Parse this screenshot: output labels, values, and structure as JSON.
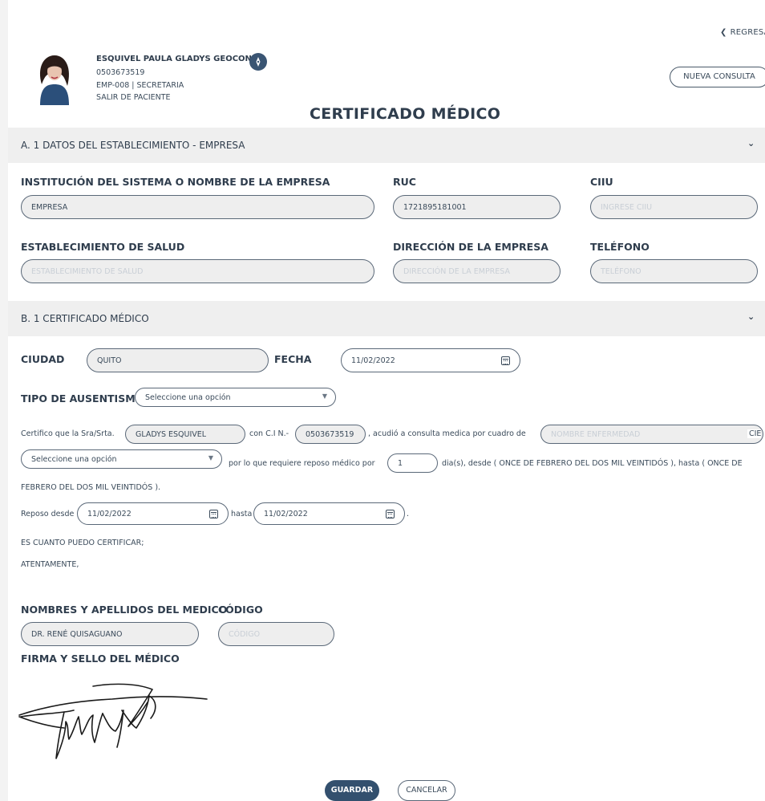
{
  "nav": {
    "back_label": "REGRESA"
  },
  "patient": {
    "name": "ESQUIVEL PAULA GLADYS GEOCONDA",
    "id_number": "0503673519",
    "employee": "EMP-008 | SECRETARIA",
    "status": "SALIR DE PACIENTE"
  },
  "actions": {
    "new_consult_label": "NUEVA CONSULTA"
  },
  "page": {
    "title": "CERTIFICADO MÉDICO"
  },
  "section_a": {
    "title": "A. 1 DATOS DEL ESTABLECIMIENTO - EMPRESA",
    "institution_label": "INSTITUCIÓN DEL SISTEMA O NOMBRE DE LA EMPRESA",
    "institution_value": "EMPRESA",
    "ruc_label": "RUC",
    "ruc_value": "1721895181001",
    "ciiu_label": "CIIU",
    "ciiu_placeholder": "INGRESE CIIU",
    "establishment_label": "ESTABLECIMIENTO DE SALUD",
    "establishment_placeholder": "ESTABLECIMIENTO DE SALUD",
    "address_label": "DIRECCIÓN DE LA EMPRESA",
    "address_placeholder": "DIRECCIÓN DE LA EMPRESA",
    "phone_label": "TELÉFONO",
    "phone_placeholder": "TELÉFONO"
  },
  "section_b": {
    "title": "B. 1 CERTIFICADO MÉDICO",
    "city_label": "CIUDAD",
    "city_value": "QUITO",
    "date_label": "FECHA",
    "date_value": "11/02/2022",
    "absence_type_label": "TIPO DE AUSENTISMO",
    "absence_type_value": "Seleccione una opción",
    "cert_text_1": "Certifico que la Sra/Srta.",
    "patient_name_value": "GLADYS  ESQUIVEL",
    "cert_text_2": "con C.I N.-",
    "ci_value": "0503673519",
    "cert_text_3": ", acudió a consulta medica por cuadro de",
    "disease_placeholder": "NOMBRE ENFERMEDAD",
    "cie_label": "CIE",
    "cie_select_value": "Seleccione una opción",
    "cert_text_4": "por lo que requiere reposo médico por",
    "rest_days_value": "1",
    "cert_text_5": "dia(s), desde ( ONCE DE FEBRERO DEL DOS MIL VEINTIDÓS ), hasta ( ONCE DE",
    "cert_text_6": "FEBRERO DEL DOS MIL VEINTIDÓS ).",
    "rest_from_label": "Reposo desde",
    "rest_from_value": "11/02/2022",
    "rest_to_label": "hasta",
    "rest_to_value": "11/02/2022",
    "period": ".",
    "closing_1": "ES CUANTO PUEDO CERTIFICAR;",
    "closing_2": "ATENTAMENTE,",
    "doctor_label": "NOMBRES Y APELLIDOS DEL MEDICO",
    "doctor_value": "DR. RENÉ QUISAGUANO",
    "code_label": "CÓDIGO",
    "code_placeholder": "CÓDIGO",
    "signature_label": "FIRMA Y SELLO DEL MÉDICO"
  },
  "footer": {
    "save_label": "GUARDAR",
    "cancel_label": "CANCELAR"
  },
  "colors": {
    "primary": "#33506e",
    "section_bg": "#efefef",
    "field_bg": "#eeeeee",
    "text": "#2f3d4d"
  }
}
